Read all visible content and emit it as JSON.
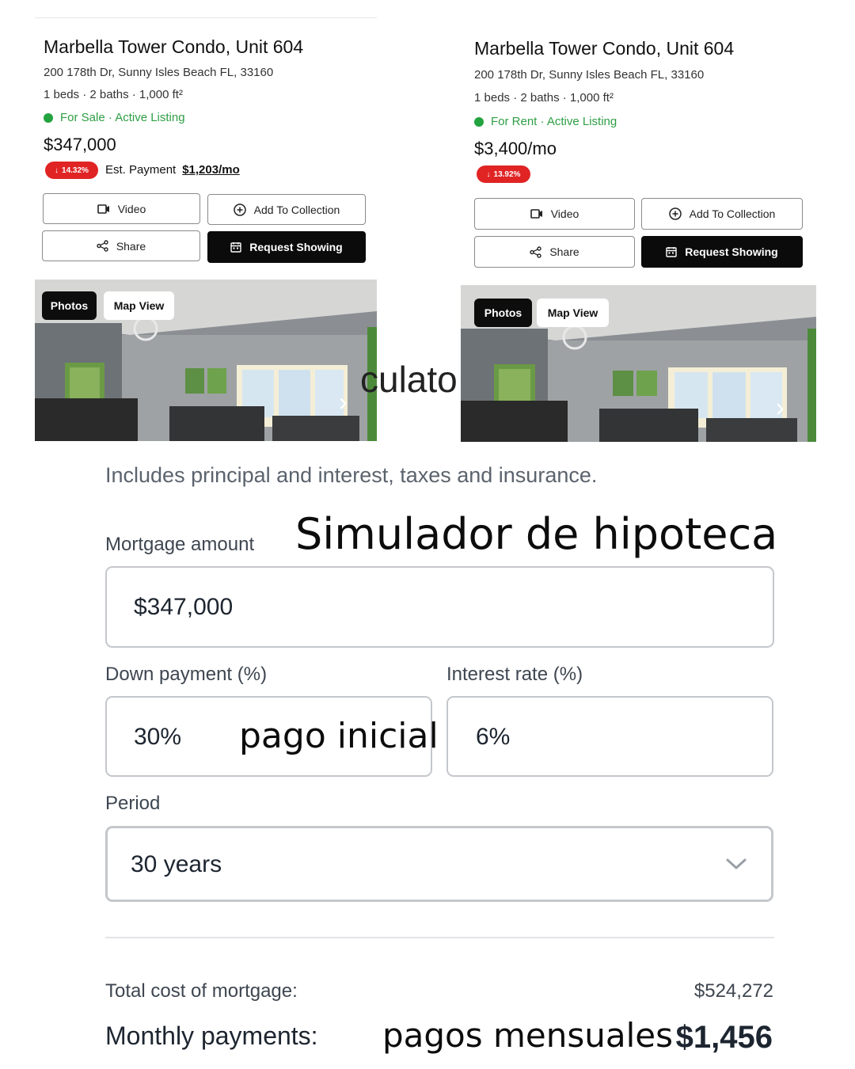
{
  "listings": [
    {
      "title": "Marbella Tower Condo, Unit 604",
      "address": "200 178th Dr, Sunny Isles Beach FL, 33160",
      "specs": "1 beds · 2 baths · 1,000 ft²",
      "status": "For Sale · Active Listing",
      "price": "$347,000",
      "change_badge": "14.32%",
      "est_payment_label": "Est. Payment",
      "est_payment_value": "$1,203/mo",
      "buttons": {
        "video": "Video",
        "add_to_collection": "Add To Collection",
        "share": "Share",
        "request_showing": "Request Showing"
      },
      "photo_tabs": {
        "photos": "Photos",
        "map_view": "Map View"
      }
    },
    {
      "title": "Marbella Tower Condo, Unit 604",
      "address": "200 178th Dr, Sunny Isles Beach FL, 33160",
      "specs": "1 beds · 2 baths · 1,000 ft²",
      "status": "For Rent · Active Listing",
      "price": "$3,400/mo",
      "change_badge": "13.92%",
      "buttons": {
        "video": "Video",
        "add_to_collection": "Add To Collection",
        "share": "Share",
        "request_showing": "Request Showing"
      },
      "photo_tabs": {
        "photos": "Photos",
        "map_view": "Map View"
      }
    }
  ],
  "calculator": {
    "partial_heading": "culato",
    "subtitle": "Includes principal and interest, taxes and insurance.",
    "mortgage_amount_label": "Mortgage amount",
    "mortgage_amount_value": "$347,000",
    "down_payment_label": "Down payment (%)",
    "down_payment_value": "30%",
    "interest_rate_label": "Interest rate (%)",
    "interest_rate_value": "6%",
    "period_label": "Period",
    "period_value": "30 years",
    "total_cost_label": "Total cost of mortgage:",
    "total_cost_value": "$524,272",
    "monthly_label": "Monthly payments:",
    "monthly_value": "$1,456"
  },
  "overlay_text": {
    "simulator": "Simulador de hipoteca",
    "down_payment": "pago inicial",
    "monthly": "pagos mensuales"
  },
  "colors": {
    "status_green": "#22a33f",
    "badge_red": "#e02424",
    "button_dark": "#0b0b0b",
    "field_border": "#c4c7cc"
  }
}
